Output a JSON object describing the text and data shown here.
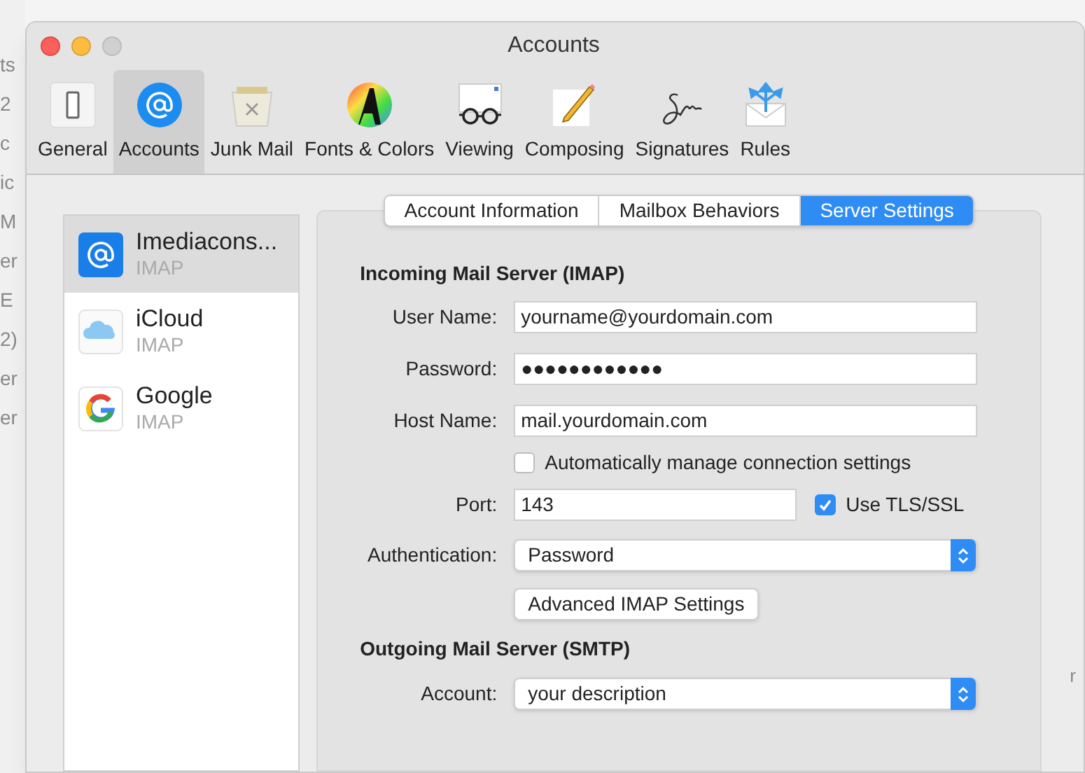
{
  "background_window": {
    "fragments": [
      "ts",
      "2",
      "c",
      "ic",
      "M",
      "er",
      "E",
      "2)",
      "er",
      "er"
    ],
    "right_fragment": "r"
  },
  "window": {
    "title": "Accounts"
  },
  "toolbar": [
    {
      "label": "General",
      "selected": false
    },
    {
      "label": "Accounts",
      "selected": true
    },
    {
      "label": "Junk Mail",
      "selected": false
    },
    {
      "label": "Fonts & Colors",
      "selected": false
    },
    {
      "label": "Viewing",
      "selected": false
    },
    {
      "label": "Composing",
      "selected": false
    },
    {
      "label": "Signatures",
      "selected": false
    },
    {
      "label": "Rules",
      "selected": false
    }
  ],
  "accounts": [
    {
      "name": "Imediacons...",
      "type": "IMAP",
      "selected": true
    },
    {
      "name": "iCloud",
      "type": "IMAP",
      "selected": false
    },
    {
      "name": "Google",
      "type": "IMAP",
      "selected": false
    }
  ],
  "tabs": [
    {
      "label": "Account Information",
      "selected": false
    },
    {
      "label": "Mailbox Behaviors",
      "selected": false
    },
    {
      "label": "Server Settings",
      "selected": true
    }
  ],
  "incoming": {
    "heading": "Incoming Mail Server (IMAP)",
    "user_name": {
      "label": "User Name:",
      "value": "yourname@yourdomain.com"
    },
    "password": {
      "label": "Password:",
      "value": "●●●●●●●●●●●●"
    },
    "host_name": {
      "label": "Host Name:",
      "value": "mail.yourdomain.com"
    },
    "auto_manage": {
      "label": "Automatically manage connection settings",
      "checked": false
    },
    "port": {
      "label": "Port:",
      "value": "143"
    },
    "use_tls": {
      "label": "Use TLS/SSL",
      "checked": true
    },
    "authentication": {
      "label": "Authentication:",
      "value": "Password"
    },
    "advanced_button": "Advanced IMAP Settings"
  },
  "outgoing": {
    "heading": "Outgoing Mail Server (SMTP)",
    "account": {
      "label": "Account:",
      "value": "your description"
    }
  }
}
